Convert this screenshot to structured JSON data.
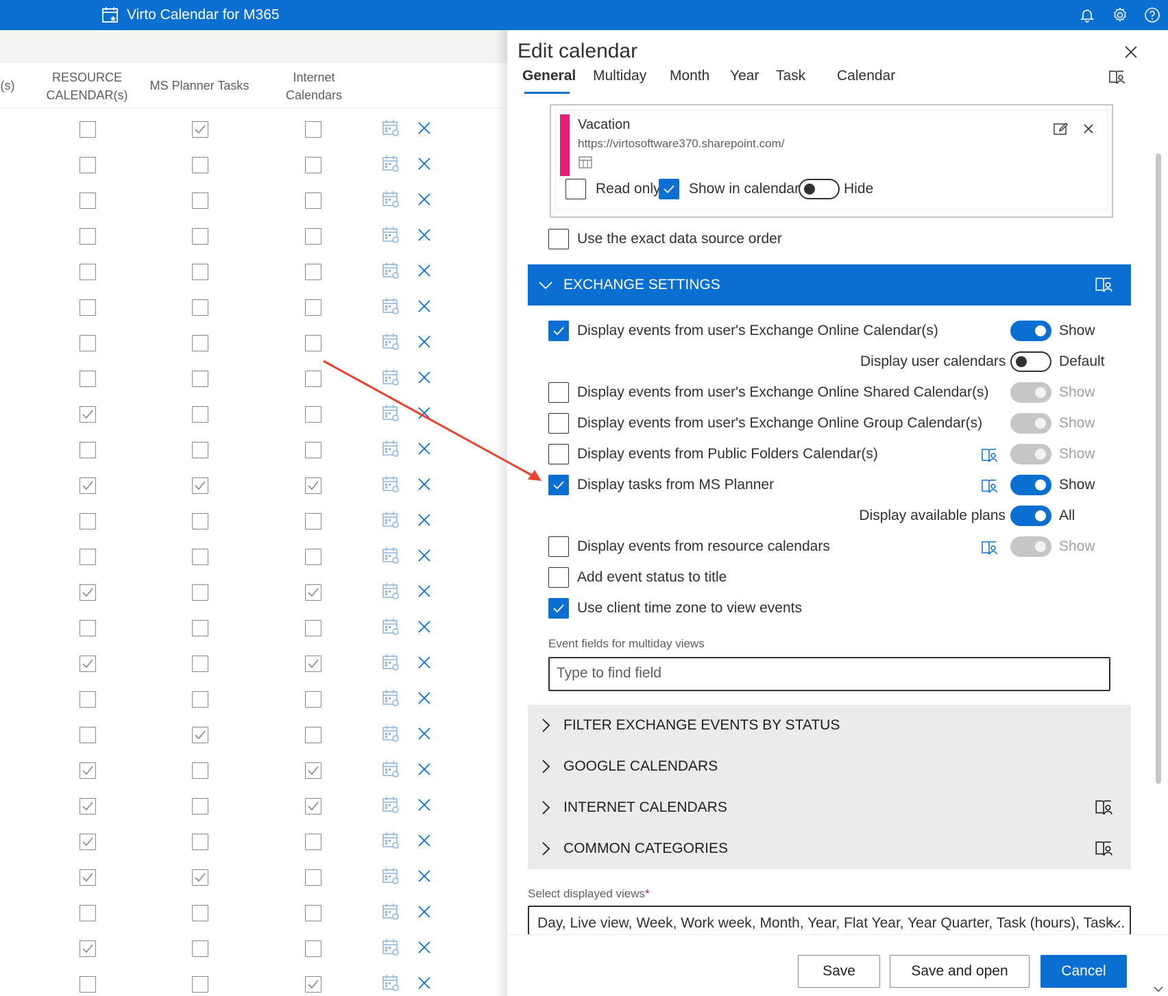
{
  "app": {
    "title": "Virto Calendar for M365"
  },
  "grid": {
    "columns": [
      "(s)",
      "RESOURCE\nCALENDAR(s)",
      "MS Planner Tasks",
      "Internet\nCalendars"
    ],
    "rows": [
      [
        false,
        true,
        false
      ],
      [
        false,
        false,
        false
      ],
      [
        false,
        false,
        false
      ],
      [
        false,
        false,
        false
      ],
      [
        false,
        false,
        false
      ],
      [
        false,
        false,
        false
      ],
      [
        false,
        false,
        false
      ],
      [
        false,
        false,
        false
      ],
      [
        true,
        false,
        false
      ],
      [
        false,
        false,
        false
      ],
      [
        true,
        true,
        true
      ],
      [
        false,
        false,
        false
      ],
      [
        false,
        false,
        false
      ],
      [
        true,
        false,
        true
      ],
      [
        false,
        false,
        false
      ],
      [
        true,
        false,
        true
      ],
      [
        false,
        false,
        false
      ],
      [
        false,
        true,
        false
      ],
      [
        true,
        false,
        true
      ],
      [
        true,
        false,
        true
      ],
      [
        true,
        false,
        false
      ],
      [
        true,
        true,
        false
      ],
      [
        false,
        false,
        false
      ],
      [
        true,
        false,
        false
      ],
      [
        false,
        false,
        true
      ]
    ]
  },
  "panel": {
    "title": "Edit calendar",
    "tabs": [
      "General",
      "Multiday",
      "Month",
      "Year",
      "Task",
      "Calendar"
    ],
    "active_tab": "General",
    "source": {
      "name": "Vacation",
      "url": "https://virtosoftware370.sharepoint.com/",
      "color": "#e81e74",
      "read_only_label": "Read only",
      "read_only": false,
      "show_in_calendar_label": "Show in calendar",
      "show_in_calendar": true,
      "hide_label": "Hide",
      "hide_on": false
    },
    "exact_order_label": "Use the exact data source order",
    "exact_order": false,
    "exchange": {
      "title": "EXCHANGE SETTINGS",
      "user_calendars_label": "Display events from user's Exchange Online Calendar(s)",
      "user_calendars_toggle_label": "Show",
      "display_user_calendars_label": "Display user calendars",
      "display_user_calendars_value": "Default",
      "shared_label": "Display events from user's Exchange Online Shared Calendar(s)",
      "shared_toggle_label": "Show",
      "group_label": "Display events from user's Exchange Online Group Calendar(s)",
      "group_toggle_label": "Show",
      "public_label": "Display events from Public Folders Calendar(s)",
      "public_toggle_label": "Show",
      "planner_label": "Display tasks from MS Planner",
      "planner_toggle_label": "Show",
      "available_plans_label": "Display available plans",
      "available_plans_value": "All",
      "resource_label": "Display events from resource calendars",
      "resource_toggle_label": "Show",
      "status_label": "Add event status to title",
      "timezone_label": "Use client time zone to view events",
      "event_fields_label": "Event fields for multiday views",
      "event_fields_placeholder": "Type to find field"
    },
    "groups": [
      "FILTER EXCHANGE EVENTS BY STATUS",
      "GOOGLE CALENDARS",
      "INTERNET CALENDARS",
      "COMMON CATEGORIES"
    ],
    "views_label": "Select displayed views",
    "views_required": "*",
    "views_value": "Day, Live view, Week, Work week, Month, Year, Flat Year, Year Quarter, Task (hours), Task...",
    "buttons": {
      "save": "Save",
      "save_open": "Save and open",
      "cancel": "Cancel"
    }
  },
  "colors": {
    "accent": "#0b6fd1",
    "annotation_arrow": "#e8432f"
  }
}
